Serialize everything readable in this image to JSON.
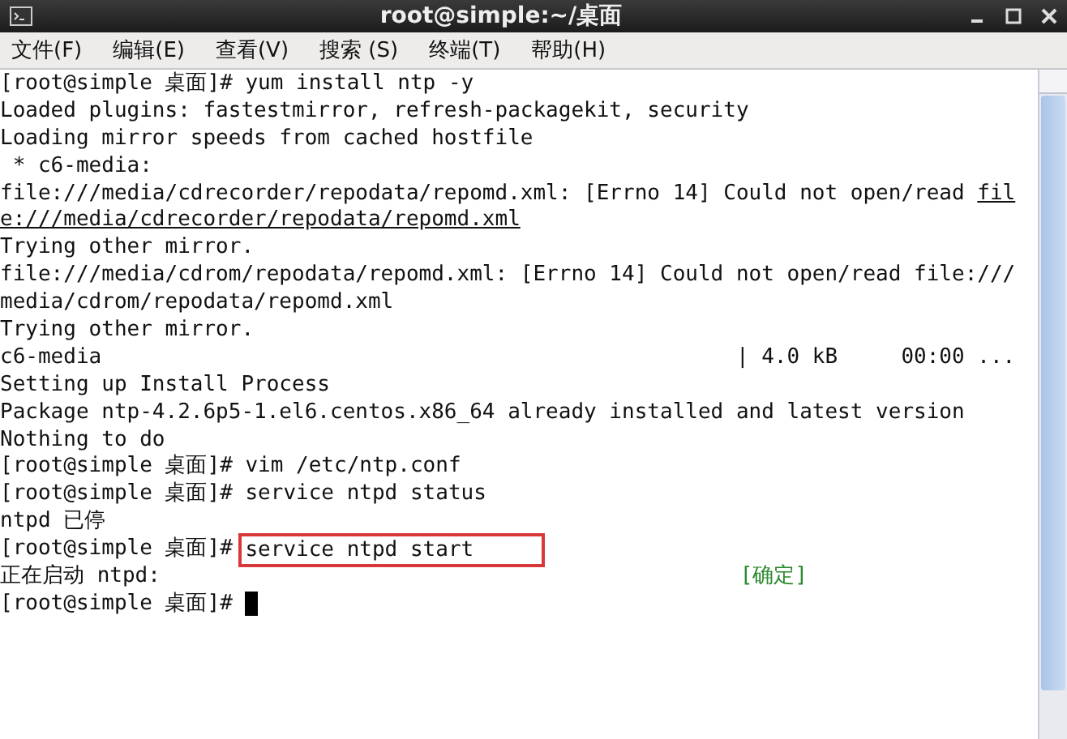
{
  "window": {
    "title": "root@simple:~/桌面"
  },
  "menu": [
    "文件(F)",
    "编辑(E)",
    "查看(V)",
    "搜索 (S)",
    "终端(T)",
    "帮助(H)"
  ],
  "terminal": {
    "lines": [
      {
        "segments": [
          {
            "kind": "prompt",
            "text": "[root@simple 桌面]#"
          },
          {
            "kind": "command",
            "text": "yum install ntp -y",
            "highlighted": false
          }
        ]
      },
      {
        "segments": [
          {
            "kind": "plain",
            "text": "Loaded plugins: fastestmirror, refresh-packagekit, security"
          }
        ]
      },
      {
        "segments": [
          {
            "kind": "plain",
            "text": "Loading mirror speeds from cached hostfile"
          }
        ]
      },
      {
        "segments": [
          {
            "kind": "plain",
            "text": " * c6-media:"
          }
        ]
      },
      {
        "segments": [
          {
            "kind": "plain",
            "text": "file:///media/cdrecorder/repodata/repomd.xml: [Errno 14] Could not open/read "
          },
          {
            "kind": "link",
            "text": "fil"
          }
        ]
      },
      {
        "segments": [
          {
            "kind": "link",
            "text": "e:///media/cdrecorder/repodata/repomd.xml"
          }
        ]
      },
      {
        "segments": [
          {
            "kind": "plain",
            "text": "Trying other mirror."
          }
        ]
      },
      {
        "segments": [
          {
            "kind": "plain",
            "text": "file:///media/cdrom/repodata/repomd.xml: [Errno 14] Could not open/read file:///"
          }
        ]
      },
      {
        "segments": [
          {
            "kind": "plain",
            "text": "media/cdrom/repodata/repomd.xml"
          }
        ]
      },
      {
        "segments": [
          {
            "kind": "plain",
            "text": "Trying other mirror."
          }
        ]
      },
      {
        "segments": [
          {
            "kind": "plain",
            "text": "c6-media                                                  | 4.0 kB     00:00 ..."
          }
        ]
      },
      {
        "segments": [
          {
            "kind": "plain",
            "text": "Setting up Install Process"
          }
        ]
      },
      {
        "segments": [
          {
            "kind": "plain",
            "text": "Package ntp-4.2.6p5-1.el6.centos.x86_64 already installed and latest version"
          }
        ]
      },
      {
        "segments": [
          {
            "kind": "plain",
            "text": "Nothing to do"
          }
        ]
      },
      {
        "segments": [
          {
            "kind": "prompt",
            "text": "[root@simple 桌面]#"
          },
          {
            "kind": "command",
            "text": "vim /etc/ntp.conf",
            "highlighted": false
          }
        ]
      },
      {
        "segments": [
          {
            "kind": "prompt",
            "text": "[root@simple 桌面]#"
          },
          {
            "kind": "command",
            "text": "service ntpd status",
            "highlighted": false
          }
        ]
      },
      {
        "segments": [
          {
            "kind": "plain",
            "text": "ntpd 已停"
          }
        ]
      },
      {
        "segments": [
          {
            "kind": "prompt",
            "text": "[root@simple 桌面]#"
          },
          {
            "kind": "command",
            "text": "service ntpd start",
            "highlighted": true
          }
        ]
      },
      {
        "segments": [
          {
            "kind": "plain",
            "text": "正在启动 ntpd:"
          },
          {
            "kind": "status_ok",
            "text": "[确定]"
          }
        ]
      },
      {
        "segments": [
          {
            "kind": "prompt",
            "text": "[root@simple 桌面]#"
          },
          {
            "kind": "cursor"
          }
        ]
      }
    ]
  }
}
